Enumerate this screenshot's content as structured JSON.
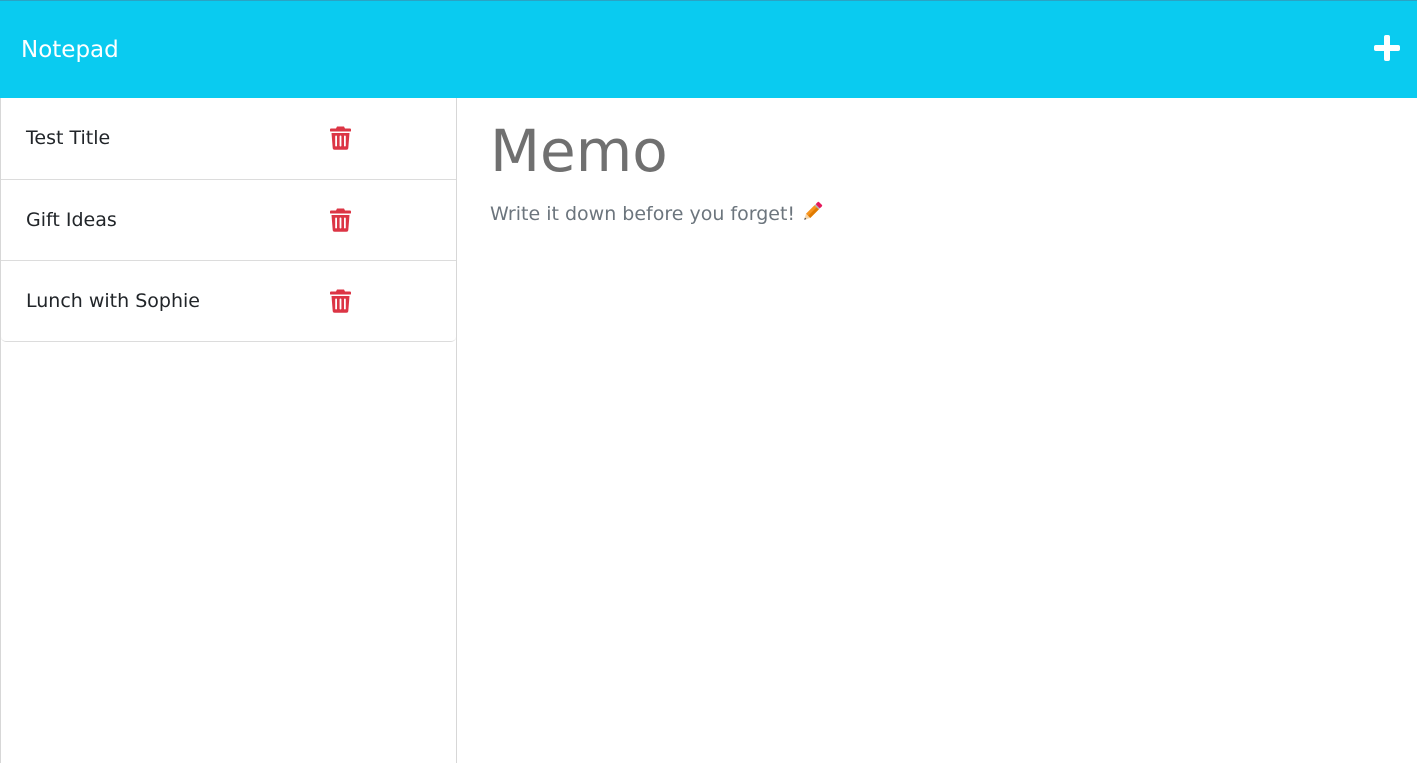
{
  "app": {
    "brand": "Notepad",
    "accent_color": "#0acbf0",
    "delete_color": "#dc3545"
  },
  "toolbar": {
    "add_icon": "plus-icon"
  },
  "notes": [
    {
      "title": "Test Title",
      "delete_icon": "trash-icon"
    },
    {
      "title": "Gift Ideas",
      "delete_icon": "trash-icon"
    },
    {
      "title": "Lunch with Sophie",
      "delete_icon": "trash-icon"
    }
  ],
  "main": {
    "title": "Memo",
    "subtitle": "Write it down before you forget!",
    "subtitle_icon": "pencil-icon"
  }
}
